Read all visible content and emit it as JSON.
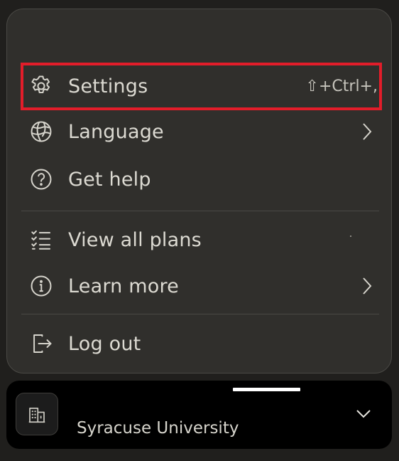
{
  "menu": {
    "items": [
      {
        "label": "Settings",
        "icon": "gear-icon",
        "shortcut": "⇧+Ctrl+,",
        "highlighted": true
      },
      {
        "label": "Language",
        "icon": "globe-icon",
        "has_submenu": true
      },
      {
        "label": "Get help",
        "icon": "help-circle-icon"
      },
      {
        "label": "View all plans",
        "icon": "checklist-icon"
      },
      {
        "label": "Learn more",
        "icon": "info-circle-icon",
        "has_submenu": true
      },
      {
        "label": "Log out",
        "icon": "logout-icon"
      }
    ]
  },
  "org": {
    "name": "Syracuse University",
    "icon": "building-icon"
  },
  "colors": {
    "panel_bg": "#302f2c",
    "text": "#dcdad2",
    "highlight_border": "#e21d2a",
    "org_bar_bg": "#000000"
  }
}
